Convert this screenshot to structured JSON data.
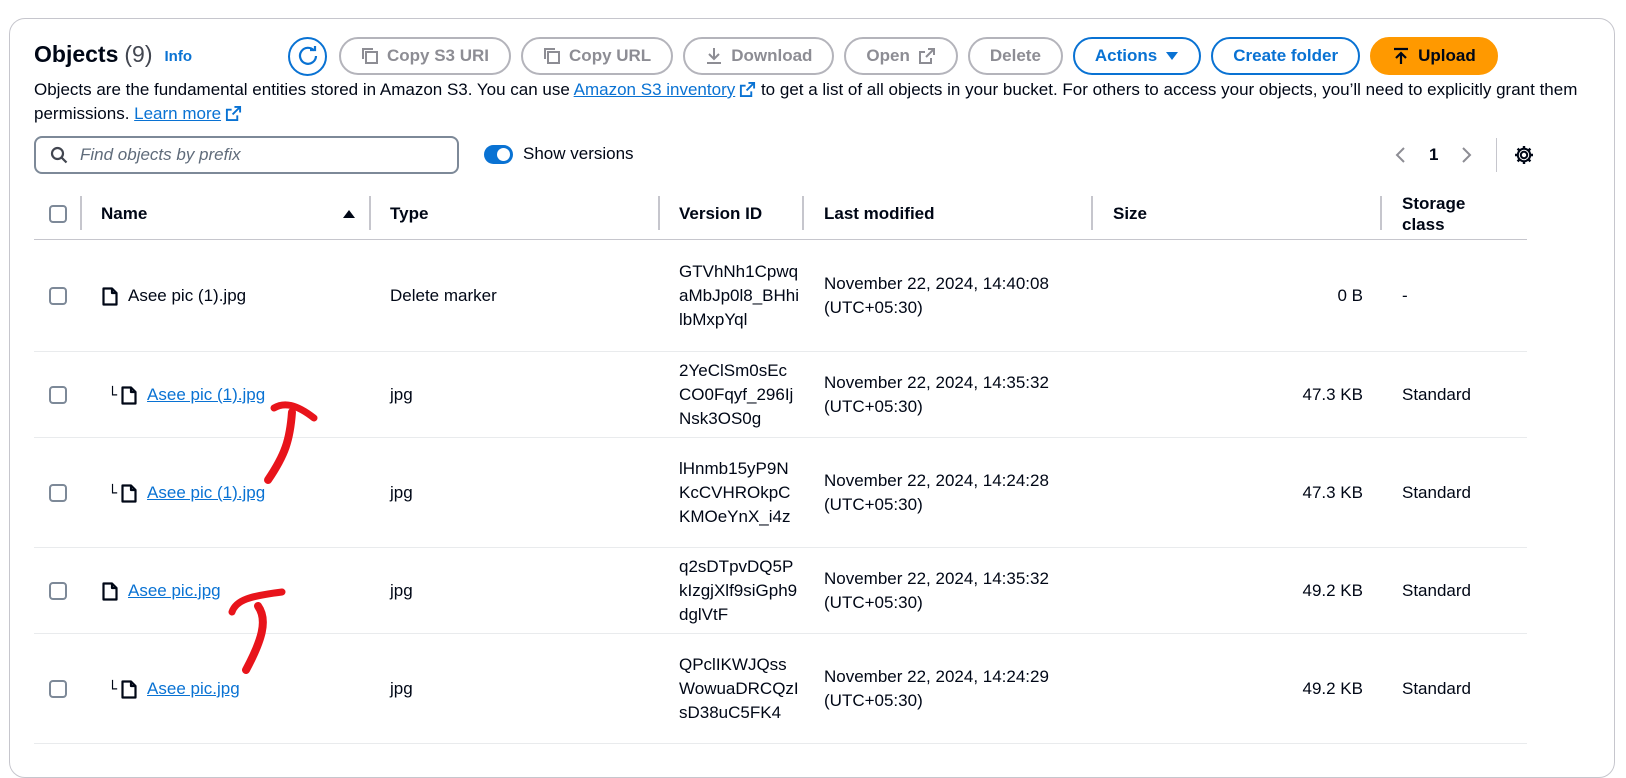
{
  "header": {
    "title": "Objects",
    "count": "(9)",
    "info": "Info"
  },
  "toolbar": {
    "copy_s3_uri": "Copy S3 URI",
    "copy_url": "Copy URL",
    "download": "Download",
    "open": "Open",
    "delete": "Delete",
    "actions": "Actions",
    "create_folder": "Create folder",
    "upload": "Upload"
  },
  "description": {
    "text1": "Objects are the fundamental entities stored in Amazon S3. You can use ",
    "link1": "Amazon S3 inventory",
    "text2": " to get a list of all objects in your bucket. For others to access your objects, you’ll need to explicitly grant them permissions. ",
    "link2": "Learn more"
  },
  "search": {
    "placeholder": "Find objects by prefix"
  },
  "show_versions": {
    "label": "Show versions",
    "enabled": true
  },
  "pagination": {
    "current_page": "1"
  },
  "table": {
    "columns": {
      "name": "Name",
      "type": "Type",
      "version_id": "Version ID",
      "last_modified": "Last modified",
      "size": "Size",
      "storage_class": "Storage class"
    },
    "rows": [
      {
        "name": "Asee pic (1).jpg",
        "is_version": false,
        "is_link": false,
        "type": "Delete marker",
        "version_id": "GTVhNh1CpwqaMbJp0l8_BHhilbMxpYql",
        "last_modified": "November 22, 2024, 14:40:08 (UTC+05:30)",
        "size": "0 B",
        "storage_class": "-"
      },
      {
        "name": "Asee pic (1).jpg",
        "is_version": true,
        "is_link": true,
        "type": "jpg",
        "version_id": "2YeClSm0sEcCO0Fqyf_296IjNsk3OS0g",
        "last_modified": "November 22, 2024, 14:35:32 (UTC+05:30)",
        "size": "47.3 KB",
        "storage_class": "Standard"
      },
      {
        "name": "Asee pic (1).jpg",
        "is_version": true,
        "is_link": true,
        "type": "jpg",
        "version_id": "lHnmb15yP9NKcCVHROkpCKMOeYnX_i4z",
        "last_modified": "November 22, 2024, 14:24:28 (UTC+05:30)",
        "size": "47.3 KB",
        "storage_class": "Standard"
      },
      {
        "name": "Asee pic.jpg",
        "is_version": false,
        "is_link": true,
        "type": "jpg",
        "version_id": "q2sDTpvDQ5PkIzgjXlf9siGph9dglVtF",
        "last_modified": "November 22, 2024, 14:35:32 (UTC+05:30)",
        "size": "49.2 KB",
        "storage_class": "Standard"
      },
      {
        "name": "Asee pic.jpg",
        "is_version": true,
        "is_link": true,
        "type": "jpg",
        "version_id": "QPclIKWJQssWowuaDRCQzIsD38uC5FK4",
        "last_modified": "November 22, 2024, 14:24:29 (UTC+05:30)",
        "size": "49.2 KB",
        "storage_class": "Standard"
      }
    ]
  },
  "colors": {
    "accent": "#0972d3",
    "upload": "#ff9900",
    "annotation": "#e8141b"
  },
  "icons": {
    "refresh": "refresh-icon",
    "copy": "copy-icon",
    "download": "download-icon",
    "external": "external-link-icon",
    "caret": "caret-down-icon",
    "upload": "upload-icon",
    "search": "search-icon",
    "file": "file-icon",
    "settings": "gear-icon"
  }
}
